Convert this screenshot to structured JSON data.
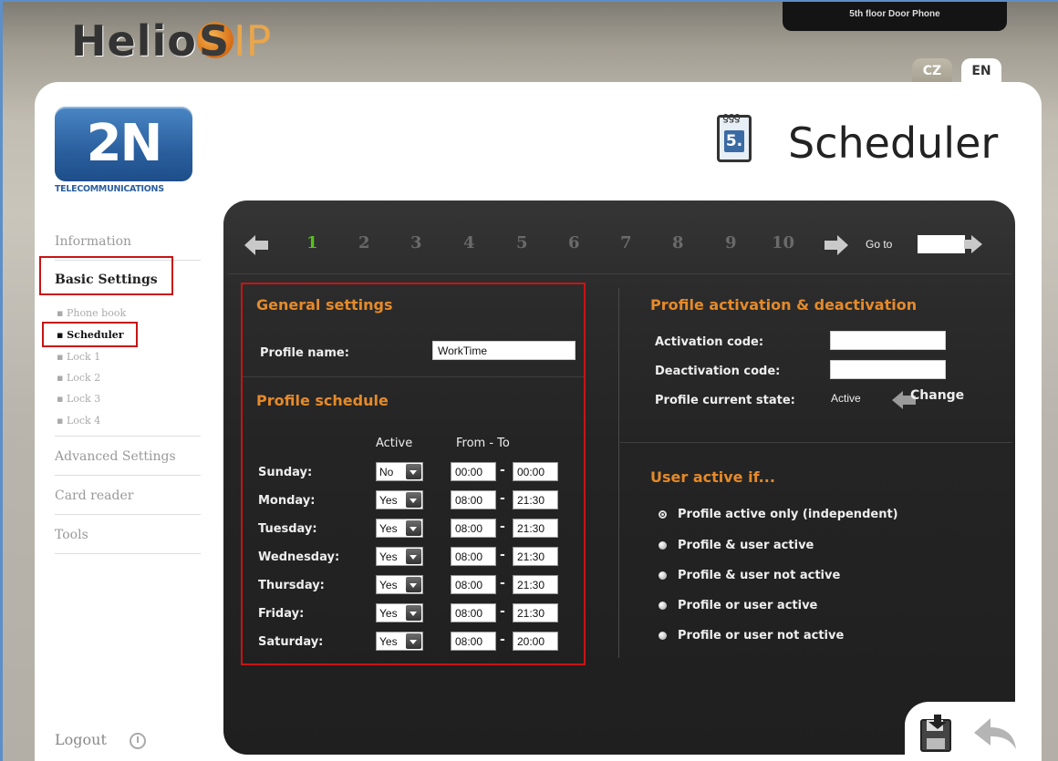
{
  "header": {
    "brand_main": "Helio",
    "brand_s": "S",
    "brand_ip": "IP",
    "device_name": "5th floor Door Phone",
    "languages": [
      "CZ",
      "EN"
    ],
    "active_language": "EN"
  },
  "logo": {
    "mark": "2N",
    "subtitle": "TELECOMMUNICATIONS"
  },
  "page": {
    "title": "Scheduler",
    "icon": "calendar-icon",
    "icon_number": "5."
  },
  "sidebar": {
    "items": [
      {
        "label": "Information"
      },
      {
        "label": "Basic Settings",
        "active": true
      },
      {
        "label": "Advanced Settings"
      },
      {
        "label": "Card reader"
      },
      {
        "label": "Tools"
      }
    ],
    "subitems": [
      {
        "label": "Phone book"
      },
      {
        "label": "Scheduler",
        "active": true
      },
      {
        "label": "Lock 1"
      },
      {
        "label": "Lock 2"
      },
      {
        "label": "Lock 3"
      },
      {
        "label": "Lock 4"
      }
    ],
    "logout": "Logout"
  },
  "pager": {
    "pages": [
      "1",
      "2",
      "3",
      "4",
      "5",
      "6",
      "7",
      "8",
      "9",
      "10"
    ],
    "current": "1",
    "goto_label": "Go to",
    "goto_value": ""
  },
  "general": {
    "title": "General settings",
    "profile_name_label": "Profile name:",
    "profile_name_value": "WorkTime"
  },
  "schedule": {
    "title": "Profile schedule",
    "col_active": "Active",
    "col_from_to": "From - To",
    "days": [
      {
        "day": "Sunday:",
        "active": "No",
        "from": "00:00",
        "to": "00:00"
      },
      {
        "day": "Monday:",
        "active": "Yes",
        "from": "08:00",
        "to": "21:30"
      },
      {
        "day": "Tuesday:",
        "active": "Yes",
        "from": "08:00",
        "to": "21:30"
      },
      {
        "day": "Wednesday:",
        "active": "Yes",
        "from": "08:00",
        "to": "21:30"
      },
      {
        "day": "Thursday:",
        "active": "Yes",
        "from": "08:00",
        "to": "21:30"
      },
      {
        "day": "Friday:",
        "active": "Yes",
        "from": "08:00",
        "to": "21:30"
      },
      {
        "day": "Saturday:",
        "active": "Yes",
        "from": "08:00",
        "to": "20:00"
      }
    ]
  },
  "activation": {
    "title": "Profile activation & deactivation",
    "activation_label": "Activation code:",
    "activation_value": "",
    "deactivation_label": "Deactivation code:",
    "deactivation_value": "",
    "state_label": "Profile current state:",
    "state_value": "Active",
    "change_label": "Change"
  },
  "user_active": {
    "title": "User active if...",
    "options": [
      {
        "label": "Profile active only (independent)",
        "checked": true
      },
      {
        "label": "Profile & user active",
        "checked": false
      },
      {
        "label": "Profile & user not active",
        "checked": false
      },
      {
        "label": "Profile or user active",
        "checked": false
      },
      {
        "label": "Profile or user not active",
        "checked": false
      }
    ]
  },
  "colors": {
    "accent": "#e58a2a",
    "pager_current": "#55c21a",
    "highlight": "#c81414",
    "panel": "#242424"
  }
}
